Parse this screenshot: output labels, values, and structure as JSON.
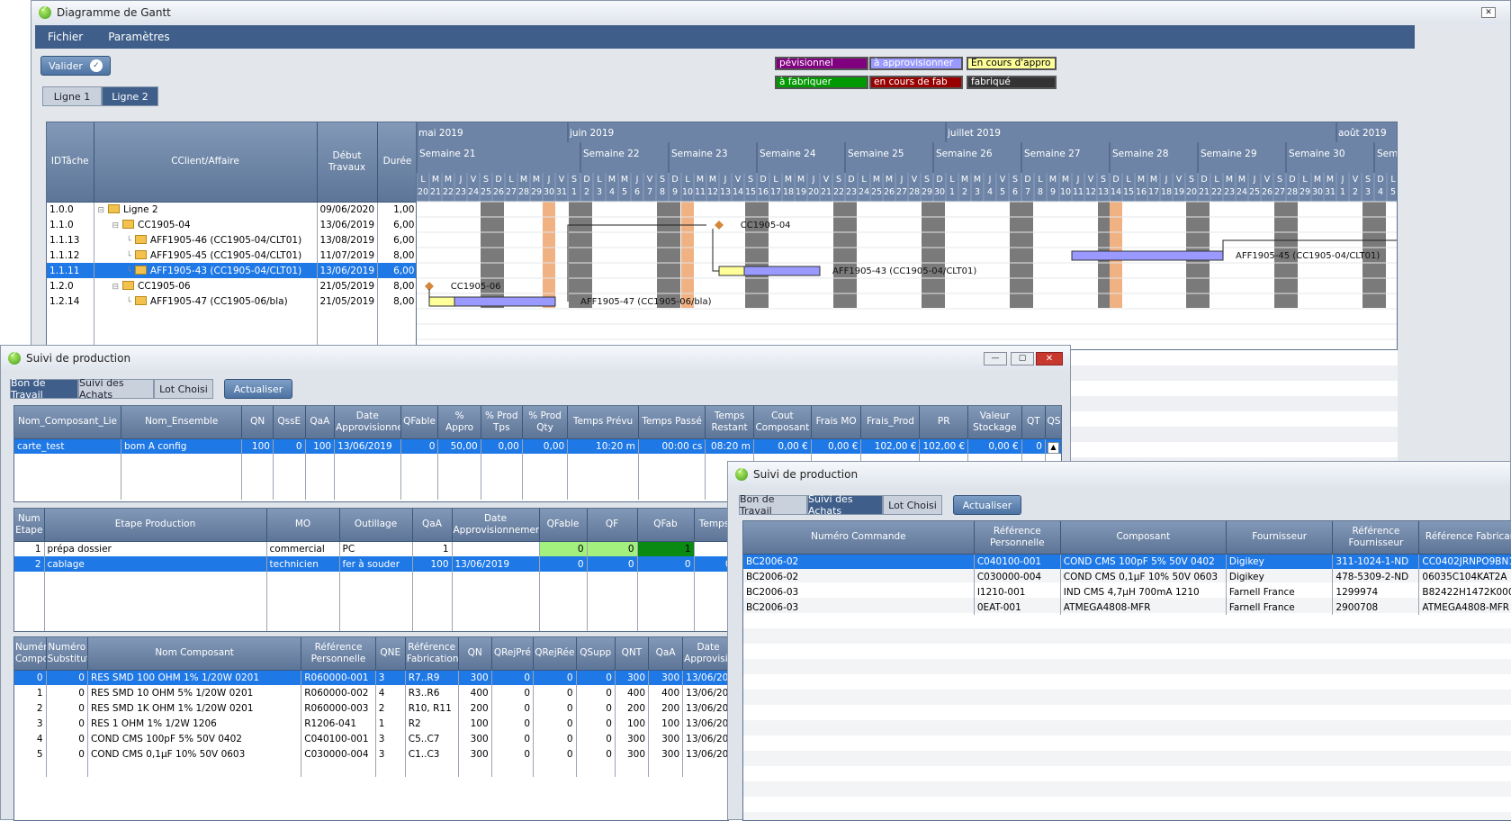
{
  "gantt": {
    "title": "Diagramme de Gantt",
    "menu": [
      "Fichier",
      "Paramètres"
    ],
    "validate_label": "Valider",
    "tabs": [
      "Ligne 1",
      "Ligne 2"
    ],
    "legend": [
      {
        "label": "pévisionnel",
        "bg": "#800080",
        "fg": "#fff"
      },
      {
        "label": "à approvisionner",
        "bg": "#9999ff",
        "fg": "#fff"
      },
      {
        "label": "En cours d'appro",
        "bg": "#ffff99",
        "fg": "#000"
      },
      {
        "label": "à fabriquer",
        "bg": "#009900",
        "fg": "#fff"
      },
      {
        "label": "en cours de fab",
        "bg": "#990000",
        "fg": "#fff"
      },
      {
        "label": "fabriqué",
        "bg": "#333333",
        "fg": "#fff"
      }
    ],
    "columns": [
      "IDTâche",
      "CClient/Affaire",
      "Début Travaux",
      "Durée"
    ],
    "rows": [
      {
        "id": "1.0.0",
        "name": "Ligne 2",
        "start": "09/06/2020",
        "dur": "1,00",
        "level": 0
      },
      {
        "id": "1.1.0",
        "name": "CC1905-04",
        "start": "13/06/2019",
        "dur": "6,00",
        "level": 1
      },
      {
        "id": "1.1.13",
        "name": "AFF1905-46 (CC1905-04/CLT01)",
        "start": "13/08/2019",
        "dur": "6,00",
        "level": 2
      },
      {
        "id": "1.1.12",
        "name": "AFF1905-45 (CC1905-04/CLT01)",
        "start": "11/07/2019",
        "dur": "8,00",
        "level": 2
      },
      {
        "id": "1.1.11",
        "name": "AFF1905-43 (CC1905-04/CLT01)",
        "start": "13/06/2019",
        "dur": "6,00",
        "level": 2,
        "selected": true
      },
      {
        "id": "1.2.0",
        "name": "CC1905-06",
        "start": "21/05/2019",
        "dur": "8,00",
        "level": 1
      },
      {
        "id": "1.2.14",
        "name": "AFF1905-47 (CC1905-06/bla)",
        "start": "21/05/2019",
        "dur": "8,00",
        "level": 2
      }
    ],
    "months": [
      {
        "label": "mai 2019",
        "day": 0
      },
      {
        "label": "juin 2019",
        "day": 12
      },
      {
        "label": "juillet 2019",
        "day": 42
      },
      {
        "label": "août 2019",
        "day": 73
      }
    ],
    "weeks": [
      "Semaine 21",
      "Semaine 22",
      "Semaine 23",
      "Semaine 24",
      "Semaine 25",
      "Semaine 26",
      "Semaine 27",
      "Semaine 28",
      "Semaine 29",
      "Semaine 30",
      "Semaine 31",
      "Se"
    ],
    "weekday_letters": [
      "L",
      "M",
      "M",
      "J",
      "V",
      "S",
      "D"
    ],
    "day_numbers": [
      "20",
      "21",
      "22",
      "23",
      "24",
      "25",
      "26",
      "27",
      "28",
      "29",
      "30",
      "31",
      "1",
      "2",
      "3",
      "4",
      "5",
      "6",
      "7",
      "8",
      "9",
      "10",
      "11",
      "12",
      "13",
      "14",
      "15",
      "16",
      "17",
      "18",
      "19",
      "20",
      "21",
      "22",
      "23",
      "24",
      "25",
      "26",
      "27",
      "28",
      "29",
      "30",
      "1",
      "2",
      "3",
      "4",
      "5",
      "6",
      "7",
      "8",
      "9",
      "10",
      "11",
      "12",
      "13",
      "14",
      "15",
      "16",
      "17",
      "18",
      "19",
      "20",
      "21",
      "22",
      "23",
      "24",
      "25",
      "26",
      "27",
      "28",
      "29",
      "30",
      "31",
      "1",
      "2",
      "3",
      "4",
      "5"
    ],
    "bar_labels": [
      "CC1905-04",
      "AFF1905-43 (CC1905-04/CLT01)",
      "AFF1905-45 (CC1905-04/CLT01)",
      "CC1905-06",
      "AFF1905-47 (CC1905-06/bla)"
    ]
  },
  "prod1": {
    "title": "Suivi de production",
    "tabs": [
      "Bon de Travail",
      "Suivi des Achats",
      "Lot Choisi"
    ],
    "refresh_label": "Actualiser",
    "t1_cols": [
      "Nom_Composant_Lie",
      "Nom_Ensemble",
      "QN",
      "QssE",
      "QaA",
      "Date Approvisionnement",
      "QFable",
      "% Appro",
      "% Prod Tps",
      "% Prod Qty",
      "Temps Prévu",
      "Temps Passé",
      "Temps Restant",
      "Cout Composant",
      "Frais MO",
      "Frais_Prod",
      "PR",
      "Valeur Stockage",
      "QT",
      "QS"
    ],
    "t1_row": [
      "carte_test",
      "bom A config",
      "100",
      "0",
      "100",
      "13/06/2019",
      "0",
      "50,00",
      "0,00",
      "0,00",
      "10:20 m",
      "00:00 cs",
      "08:20 m",
      "0,00 €",
      "0,00 €",
      "102,00 €",
      "102,00 €",
      "0,00 €",
      "0",
      "0"
    ],
    "t2_cols": [
      "Num Etape",
      "Etape Production",
      "MO",
      "Outillage",
      "QaA",
      "Date Approvisionnement",
      "QFable",
      "QF",
      "QFab",
      "Temps"
    ],
    "t2_rows": [
      [
        "1",
        "prépa dossier",
        "commercial",
        "PC",
        "1",
        "",
        "0",
        "0",
        "1",
        ""
      ],
      [
        "2",
        "cablage",
        "technicien",
        "fer à souder",
        "100",
        "13/06/2019",
        "0",
        "0",
        "0",
        "0"
      ]
    ],
    "t3_cols": [
      "Numéro Composant",
      "Numéro Substitut",
      "Nom Composant",
      "Référence Personnelle",
      "QNE",
      "Référence Fabrication",
      "QN",
      "QRejPré",
      "QRejRée",
      "QSupp",
      "QNT",
      "QaA",
      "Date Approvisionnement"
    ],
    "t3_rows": [
      [
        "0",
        "0",
        "RES SMD 100 OHM 1% 1/20W 0201",
        "R060000-001",
        "3",
        "R7..R9",
        "300",
        "0",
        "0",
        "0",
        "300",
        "300",
        "13/06/2019"
      ],
      [
        "1",
        "0",
        "RES SMD 10 OHM 5% 1/20W 0201",
        "R060000-002",
        "4",
        "R3..R6",
        "400",
        "0",
        "0",
        "0",
        "400",
        "400",
        "13/06/2019"
      ],
      [
        "2",
        "0",
        "RES SMD 1K OHM 1% 1/20W 0201",
        "R060000-003",
        "2",
        "R10, R11",
        "200",
        "0",
        "0",
        "0",
        "200",
        "200",
        "13/06/2019"
      ],
      [
        "3",
        "0",
        "RES 1 OHM 1% 1/2W 1206",
        "R1206-041",
        "1",
        "R2",
        "100",
        "0",
        "0",
        "0",
        "100",
        "100",
        "13/06/2019"
      ],
      [
        "4",
        "0",
        "COND CMS 100pF 5% 50V 0402",
        "C040100-001",
        "3",
        "C5..C7",
        "300",
        "0",
        "0",
        "0",
        "300",
        "300",
        "13/06/2019"
      ],
      [
        "5",
        "0",
        "COND CMS 0,1µF 10% 50V 0603",
        "C030000-004",
        "3",
        "C1..C3",
        "300",
        "0",
        "0",
        "0",
        "300",
        "300",
        "13/06/2019"
      ]
    ]
  },
  "prod2": {
    "title": "Suivi de production",
    "tabs": [
      "Bon de Travail",
      "Suivi des Achats",
      "Lot Choisi"
    ],
    "refresh_label": "Actualiser",
    "cols": [
      "Numéro Commande",
      "Référence Personnelle",
      "Composant",
      "Fournisseur",
      "Référence Fournisseur",
      "Référence Fabricant"
    ],
    "rows": [
      [
        "BC2006-02",
        "C040100-001",
        "COND CMS 100pF 5% 50V 0402",
        "Digikey",
        "311-1024-1-ND",
        "CC0402JRNPO9BN101"
      ],
      [
        "BC2006-02",
        "C030000-004",
        "COND CMS 0,1µF 10% 50V 0603",
        "Digikey",
        "478-5309-2-ND",
        "06035C104KAT2A"
      ],
      [
        "BC2006-03",
        "I1210-001",
        "IND CMS 4,7µH 700mA 1210",
        "Farnell France",
        "1299974",
        "B82422H1472K000"
      ],
      [
        "BC2006-03",
        "0EAT-001",
        "ATMEGA4808-MFR",
        "Farnell France",
        "2900708",
        "ATMEGA4808-MFR"
      ]
    ]
  }
}
